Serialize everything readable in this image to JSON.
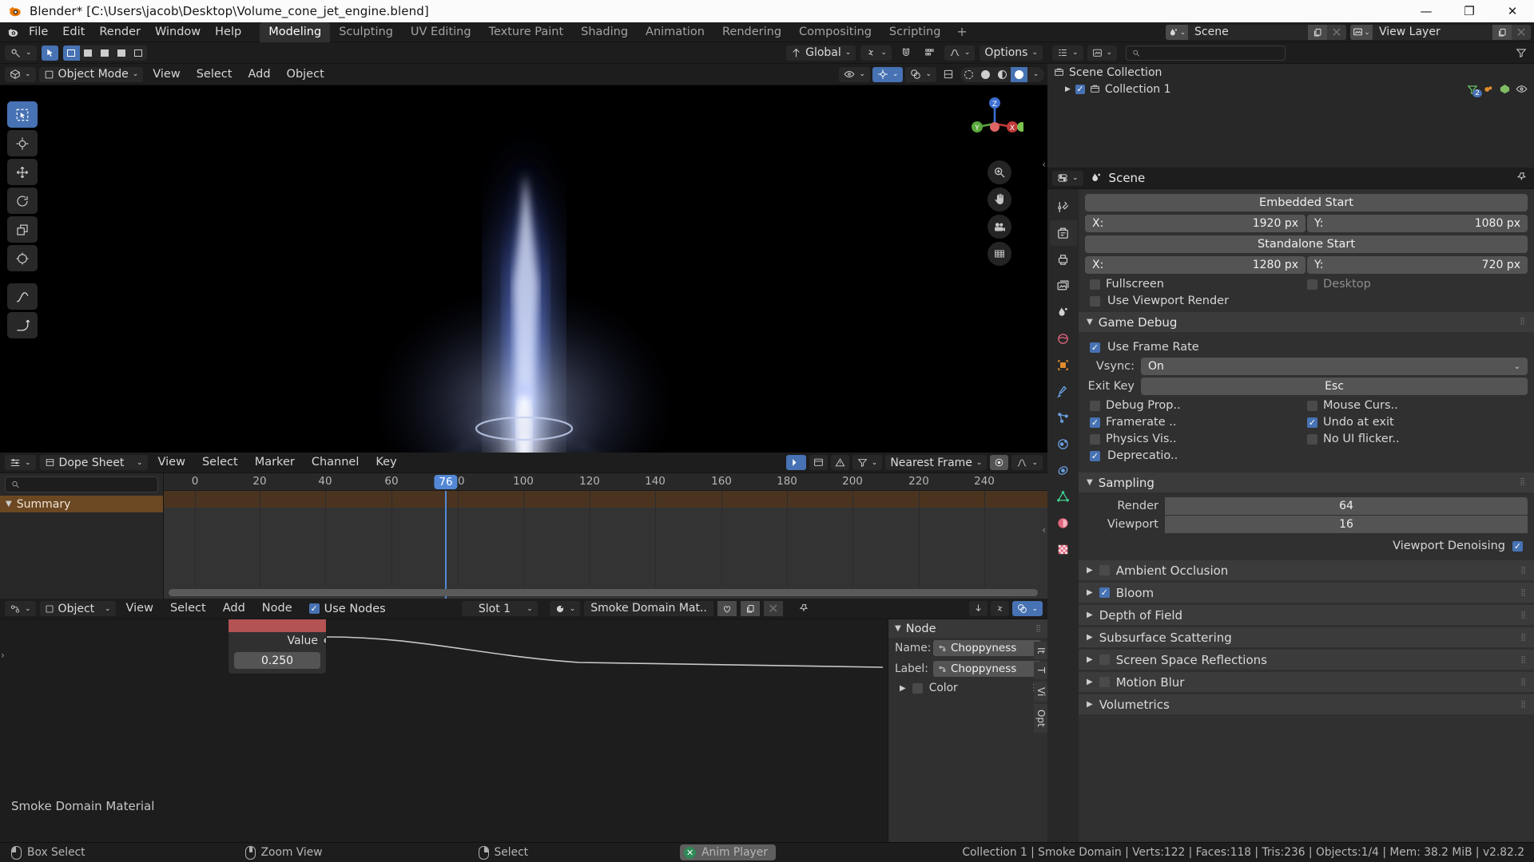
{
  "window": {
    "title": "Blender* [C:\\Users\\jacob\\Desktop\\Volume_cone_jet_engine.blend]",
    "minimize": "—",
    "maximize": "❐",
    "close": "✕"
  },
  "topbar": {
    "menus": [
      "File",
      "Edit",
      "Render",
      "Window",
      "Help"
    ],
    "workspaces": [
      {
        "label": "Modeling",
        "active": true
      },
      {
        "label": "Sculpting",
        "active": false
      },
      {
        "label": "UV Editing",
        "active": false
      },
      {
        "label": "Texture Paint",
        "active": false
      },
      {
        "label": "Shading",
        "active": false
      },
      {
        "label": "Animation",
        "active": false
      },
      {
        "label": "Rendering",
        "active": false
      },
      {
        "label": "Compositing",
        "active": false
      },
      {
        "label": "Scripting",
        "active": false
      }
    ],
    "add_workspace": "+",
    "scene_name": "Scene",
    "view_layer_name": "View Layer"
  },
  "toolrow": {
    "transform_orientation": "Global",
    "options_label": "Options"
  },
  "viewport": {
    "mode": "Object Mode",
    "menus": [
      "View",
      "Select",
      "Add",
      "Object"
    ]
  },
  "outliner": {
    "search_placeholder": "",
    "rows": [
      {
        "label": "Scene Collection",
        "indent": 0
      },
      {
        "label": "Collection 1",
        "indent": 1,
        "badge": "2"
      }
    ]
  },
  "properties": {
    "context_name": "Scene",
    "embedded_start": "Embedded Start",
    "embedded_x_label": "X:",
    "embedded_x_value": "1920 px",
    "embedded_y_label": "Y:",
    "embedded_y_value": "1080 px",
    "standalone_start": "Standalone Start",
    "standalone_x_label": "X:",
    "standalone_x_value": "1280 px",
    "standalone_y_label": "Y:",
    "standalone_y_value": "720 px",
    "fullscreen": "Fullscreen",
    "desktop": "Desktop",
    "use_viewport_render": "Use Viewport Render",
    "game_debug_title": "Game Debug",
    "use_frame_rate": "Use Frame Rate",
    "vsync_label": "Vsync:",
    "vsync_value": "On",
    "exit_key_label": "Exit Key",
    "exit_key_value": "Esc",
    "debug_prop": "Debug Prop..",
    "mouse_curs": "Mouse Curs..",
    "framerate": "Framerate ..",
    "undo_at_exit": "Undo at exit",
    "physics_vis": "Physics Vis..",
    "no_ui_flicker": "No UI flicker..",
    "deprecation": "Deprecatio..",
    "sampling_title": "Sampling",
    "render_label": "Render",
    "render_value": "64",
    "viewport_label": "Viewport",
    "viewport_value": "16",
    "viewport_denoising": "Viewport Denoising",
    "collapsed_sections": [
      "Ambient Occlusion",
      "Bloom",
      "Depth of Field",
      "Subsurface Scattering",
      "Screen Space Reflections",
      "Motion Blur",
      "Volumetrics"
    ],
    "bloom_checked": true
  },
  "dopesheet": {
    "editor_name": "Dope Sheet",
    "menus": [
      "View",
      "Select",
      "Marker",
      "Channel",
      "Key"
    ],
    "search_placeholder": "",
    "summary_label": "Summary",
    "snap_mode": "Nearest Frame",
    "current_frame": "76",
    "ruler_ticks": [
      "0",
      "20",
      "40",
      "60",
      "80",
      "100",
      "120",
      "140",
      "160",
      "180",
      "200",
      "220",
      "240"
    ]
  },
  "nodeeditor": {
    "editor_type": "Object",
    "menus": [
      "View",
      "Select",
      "Add",
      "Node"
    ],
    "use_nodes": "Use Nodes",
    "slot": "Slot 1",
    "material_name": "Smoke Domain Mat..",
    "material_caption": "Smoke Domain Material",
    "node_socket_label": "Value",
    "node_value": "0.250",
    "npanel": {
      "title": "Node",
      "name_label": "Name:",
      "name_value": "Choppyness",
      "label_label": "Label:",
      "label_value": "Choppyness",
      "color_label": "Color",
      "tabs": [
        "It",
        "T",
        "Vi",
        "Opt"
      ]
    }
  },
  "statusbar": {
    "hints": [
      {
        "icon": "mouse-left",
        "label": "Box Select"
      },
      {
        "icon": "mouse-middle",
        "label": "Zoom View"
      },
      {
        "icon": "mouse-right",
        "label": "Select"
      }
    ],
    "anim_player": "Anim Player",
    "info": "Collection 1 | Smoke Domain | Verts:122 | Faces:118 | Tris:236 | Objects:1/4 | Mem: 38.2 MiB | v2.82.2"
  },
  "colors": {
    "accent_blue": "#4772b3",
    "orange": "#e87d0d",
    "summary_band": "#6b4821",
    "node_header": "#b35353"
  }
}
